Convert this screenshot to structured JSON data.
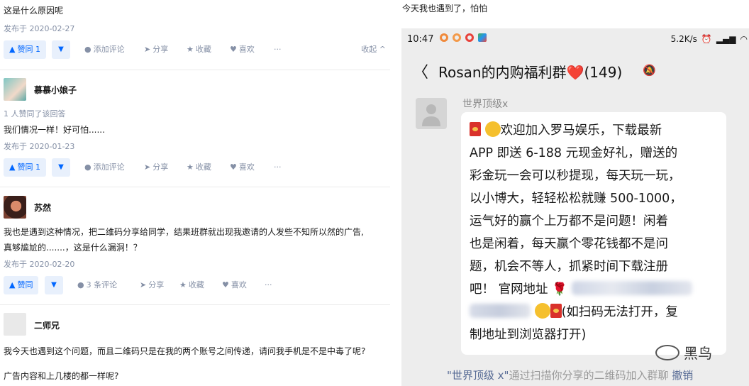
{
  "left": {
    "answer1": {
      "text": "这是什么原因呢",
      "date": "发布于 2020-02-27",
      "vote_label": "赞同 1",
      "comment_label": "添加评论",
      "share_label": "分享",
      "fav_label": "收藏",
      "like_label": "喜欢",
      "more_label": "···",
      "collapse_label": "收起 ^"
    },
    "answer2": {
      "username": "慕慕小娘子",
      "liked": "1 人赞同了该回答",
      "text": "我们情况一样！好可怕......",
      "date": "发布于 2020-01-23",
      "vote_label": "赞同 1",
      "comment_label": "添加评论",
      "share_label": "分享",
      "fav_label": "收藏",
      "like_label": "喜欢",
      "more_label": "···"
    },
    "answer3": {
      "username": "苏然",
      "text_line1": "我也是遇到这种情况，把二维码分享给同学，结果班群就出现我邀请的人发些不知所以然的广告,",
      "text_line2": "真够尴尬的.......，这是什么漏洞！？",
      "date": "发布于 2020-02-20",
      "vote_label": "赞同",
      "comment_label": "3 条评论",
      "share_label": "分享",
      "fav_label": "收藏",
      "like_label": "喜欢",
      "more_label": "···"
    },
    "answer4": {
      "username": "二师兄",
      "text_line1": "我今天也遇到这个问题，而且二维码只是在我的两个账号之间传递，请问我手机是不是中毒了呢?",
      "text_line2": "广告内容和上几楼的都一样呢?"
    }
  },
  "right": {
    "caption": "今天我也遇到了，怕怕",
    "status_time": "10:47",
    "status_speed": "5.2K/s",
    "chat_title": "Rosan的内购福利群❤️(149)",
    "sender": "世界顶级x",
    "message_lines": [
      "欢迎加入罗马娱乐，下载最新",
      "APP 即送 6-188 元现金好礼，赠送的",
      "彩金玩一会可以秒提现，每天玩一玩，",
      "以小博大，轻轻松松就赚 500-1000，",
      "运气好的赢个上万都不是问题！闲着",
      "也是闲着，每天赢个零花钱都不是问",
      "题，机会不等人，抓紧时间下载注册",
      "吧！  官网地址",
      "(如扫码无法打开，复",
      "制地址到浏览器打开)"
    ],
    "system_msg_name": "\"世界顶级 x\"",
    "system_msg_text": "通过扫描你分享的二维码加入群聊",
    "system_msg_action": "撤销",
    "watermark": "黑鸟"
  },
  "icons": [
    "up-arrow-icon",
    "down-arrow-icon",
    "comment-icon",
    "share-icon",
    "star-icon",
    "heart-icon",
    "back-arrow-icon",
    "mute-bell-icon",
    "alarm-icon",
    "signal-icon",
    "wifi-icon"
  ],
  "colors": {
    "accent": "#0066ff",
    "accent_bg": "#e8f0fc",
    "meta": "#8590a6",
    "chat_bg": "#ededed",
    "link": "#576b95"
  }
}
